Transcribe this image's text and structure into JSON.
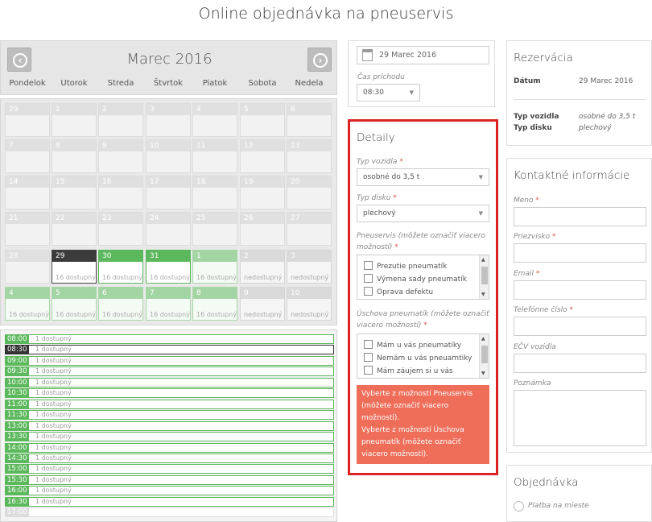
{
  "page_title": "Online objednávka na pneuservis",
  "calendar": {
    "month": "Marec 2016",
    "weekdays": [
      "Pondelok",
      "Utorok",
      "Streda",
      "Štvrtok",
      "Piatok",
      "Sobota",
      "Nedela"
    ],
    "weeks": [
      [
        {
          "d": "29"
        },
        {
          "d": "1"
        },
        {
          "d": "2"
        },
        {
          "d": "3"
        },
        {
          "d": "4"
        },
        {
          "d": "5"
        },
        {
          "d": "6"
        }
      ],
      [
        {
          "d": "7"
        },
        {
          "d": "8"
        },
        {
          "d": "9"
        },
        {
          "d": "10"
        },
        {
          "d": "11"
        },
        {
          "d": "12"
        },
        {
          "d": "13"
        }
      ],
      [
        {
          "d": "14"
        },
        {
          "d": "15"
        },
        {
          "d": "16"
        },
        {
          "d": "17"
        },
        {
          "d": "18"
        },
        {
          "d": "19"
        },
        {
          "d": "20"
        }
      ],
      [
        {
          "d": "21"
        },
        {
          "d": "22"
        },
        {
          "d": "23"
        },
        {
          "d": "24"
        },
        {
          "d": "25"
        },
        {
          "d": "26"
        },
        {
          "d": "27"
        }
      ],
      [
        {
          "d": "28"
        },
        {
          "d": "29",
          "s": "16 dostupný",
          "st": "sel"
        },
        {
          "d": "30",
          "s": "16 dostupný",
          "st": "av"
        },
        {
          "d": "31",
          "s": "16 dostupný",
          "st": "av"
        },
        {
          "d": "1",
          "s": "16 dostupný",
          "st": "pa"
        },
        {
          "d": "2",
          "s": "nedostupný",
          "st": "ua"
        },
        {
          "d": "3",
          "s": "nedostupný",
          "st": "ua"
        }
      ],
      [
        {
          "d": "4",
          "s": "16 dostupný",
          "st": "pa"
        },
        {
          "d": "5",
          "s": "16 dostupný",
          "st": "pa"
        },
        {
          "d": "6",
          "s": "16 dostupný",
          "st": "pa"
        },
        {
          "d": "7",
          "s": "16 dostupný",
          "st": "pa"
        },
        {
          "d": "8",
          "s": "16 dostupný",
          "st": "pa"
        },
        {
          "d": "9",
          "s": "nedostupný",
          "st": "ua"
        },
        {
          "d": "10",
          "s": "nedostupný",
          "st": "ua"
        }
      ]
    ]
  },
  "timeslots": [
    {
      "t": "08:00",
      "s": "1 dostupný",
      "st": "av"
    },
    {
      "t": "08:30",
      "s": "1 dostupný",
      "st": "sel"
    },
    {
      "t": "09:00",
      "s": "1 dostupný",
      "st": "av"
    },
    {
      "t": "09:30",
      "s": "1 dostupný",
      "st": "av"
    },
    {
      "t": "10:00",
      "s": "1 dostupný",
      "st": "av"
    },
    {
      "t": "10:30",
      "s": "1 dostupný",
      "st": "av"
    },
    {
      "t": "11:00",
      "s": "1 dostupný",
      "st": "av"
    },
    {
      "t": "11:30",
      "s": "1 dostupný",
      "st": "av"
    },
    {
      "t": "13:00",
      "s": "1 dostupný",
      "st": "av"
    },
    {
      "t": "13:30",
      "s": "1 dostupný",
      "st": "av"
    },
    {
      "t": "14:00",
      "s": "1 dostupný",
      "st": "av"
    },
    {
      "t": "14:30",
      "s": "1 dostupný",
      "st": "av"
    },
    {
      "t": "15:00",
      "s": "1 dostupný",
      "st": "av"
    },
    {
      "t": "15:30",
      "s": "1 dostupný",
      "st": "av"
    },
    {
      "t": "16:00",
      "s": "1 dostupný",
      "st": "av"
    },
    {
      "t": "16:30",
      "s": "1 dostupný",
      "st": "av"
    },
    {
      "t": "17:00",
      "s": "",
      "st": "dis"
    }
  ],
  "date_time": {
    "date_value": "29 Marec 2016",
    "arrival_label": "Čas príchodu",
    "arrival_value": "08:30"
  },
  "details": {
    "heading": "Detaily",
    "vehicle_label": "Typ vozidla",
    "vehicle_value": "osobné do 3,5 t",
    "disk_label": "Typ disku",
    "disk_value": "plechový",
    "service_label": "Pneuservis (môžete označiť viacero možností)",
    "service_options": [
      "Prezutie pneumatík",
      "Výmena sady pneumatík",
      "Oprava defektu"
    ],
    "storage_label": "Úschova pneumatík (môžete označiť viacero možností)",
    "storage_options": [
      "Mám u vás pneumatiky",
      "Nemám u vás pneuamtiky",
      "Mám záujem si u vás"
    ],
    "alert_lines": [
      "Vyberte z možností Pneuservis (môžete označiť viacero možností).",
      "Vyberte z možností Úschova pneumatík (môžete označiť viacero možností)."
    ]
  },
  "reservation": {
    "heading": "Rezervácia",
    "date_label": "Dátum",
    "date_value": "29 Marec 2016",
    "vehicle_label": "Typ vozidla",
    "vehicle_value": "osobné do 3,5 t",
    "disk_label": "Typ disku",
    "disk_value": "plechový"
  },
  "contact": {
    "heading": "Kontaktné informácie",
    "name_label": "Meno",
    "surname_label": "Priezvisko",
    "email_label": "Email",
    "phone_label": "Telefónne číslo",
    "plate_label": "EČV vozidla",
    "note_label": "Poznámka"
  },
  "order": {
    "heading": "Objednávka",
    "payment_label": "Platba na mieste"
  },
  "colors": {
    "available": "#5cb85c",
    "selected": "#333333",
    "alert": "#ef6e5a",
    "highlight_border": "#dd2222"
  }
}
